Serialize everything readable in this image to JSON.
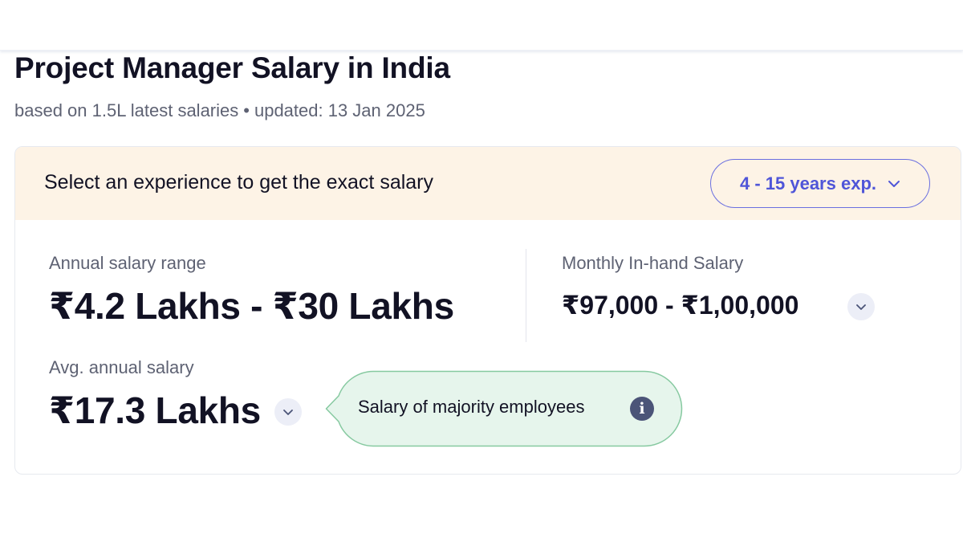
{
  "page": {
    "title": "Project Manager Salary in India",
    "subtitle": {
      "based_on": "based on 1.5L latest salaries",
      "separator": "•",
      "updated": "updated: 13 Jan 2025"
    }
  },
  "experience_bar": {
    "prompt": "Select an experience to get the exact salary",
    "selected_value": "4 - 15 years exp.",
    "dropdown_icon": "chevron-down-icon"
  },
  "salary": {
    "annual_range": {
      "label": "Annual salary range",
      "value": "₹4.2 Lakhs - ₹30 Lakhs"
    },
    "monthly_inhand": {
      "label": "Monthly In-hand Salary",
      "value": "₹97,000 - ₹1,00,000",
      "expand_icon": "chevron-down-icon"
    },
    "average_annual": {
      "label": "Avg. annual salary",
      "value": "₹17.3 Lakhs",
      "expand_icon": "chevron-down-icon"
    }
  },
  "tooltip": {
    "text": "Salary of majority employees",
    "icon": "info-icon",
    "icon_glyph": "i"
  },
  "colors": {
    "accent": "#4f55d8",
    "header_background": "#fdf3e6",
    "tooltip_background": "#e6f5ec",
    "tooltip_border": "#86c9a0",
    "text_primary": "#121224",
    "text_secondary": "#5e6273"
  }
}
